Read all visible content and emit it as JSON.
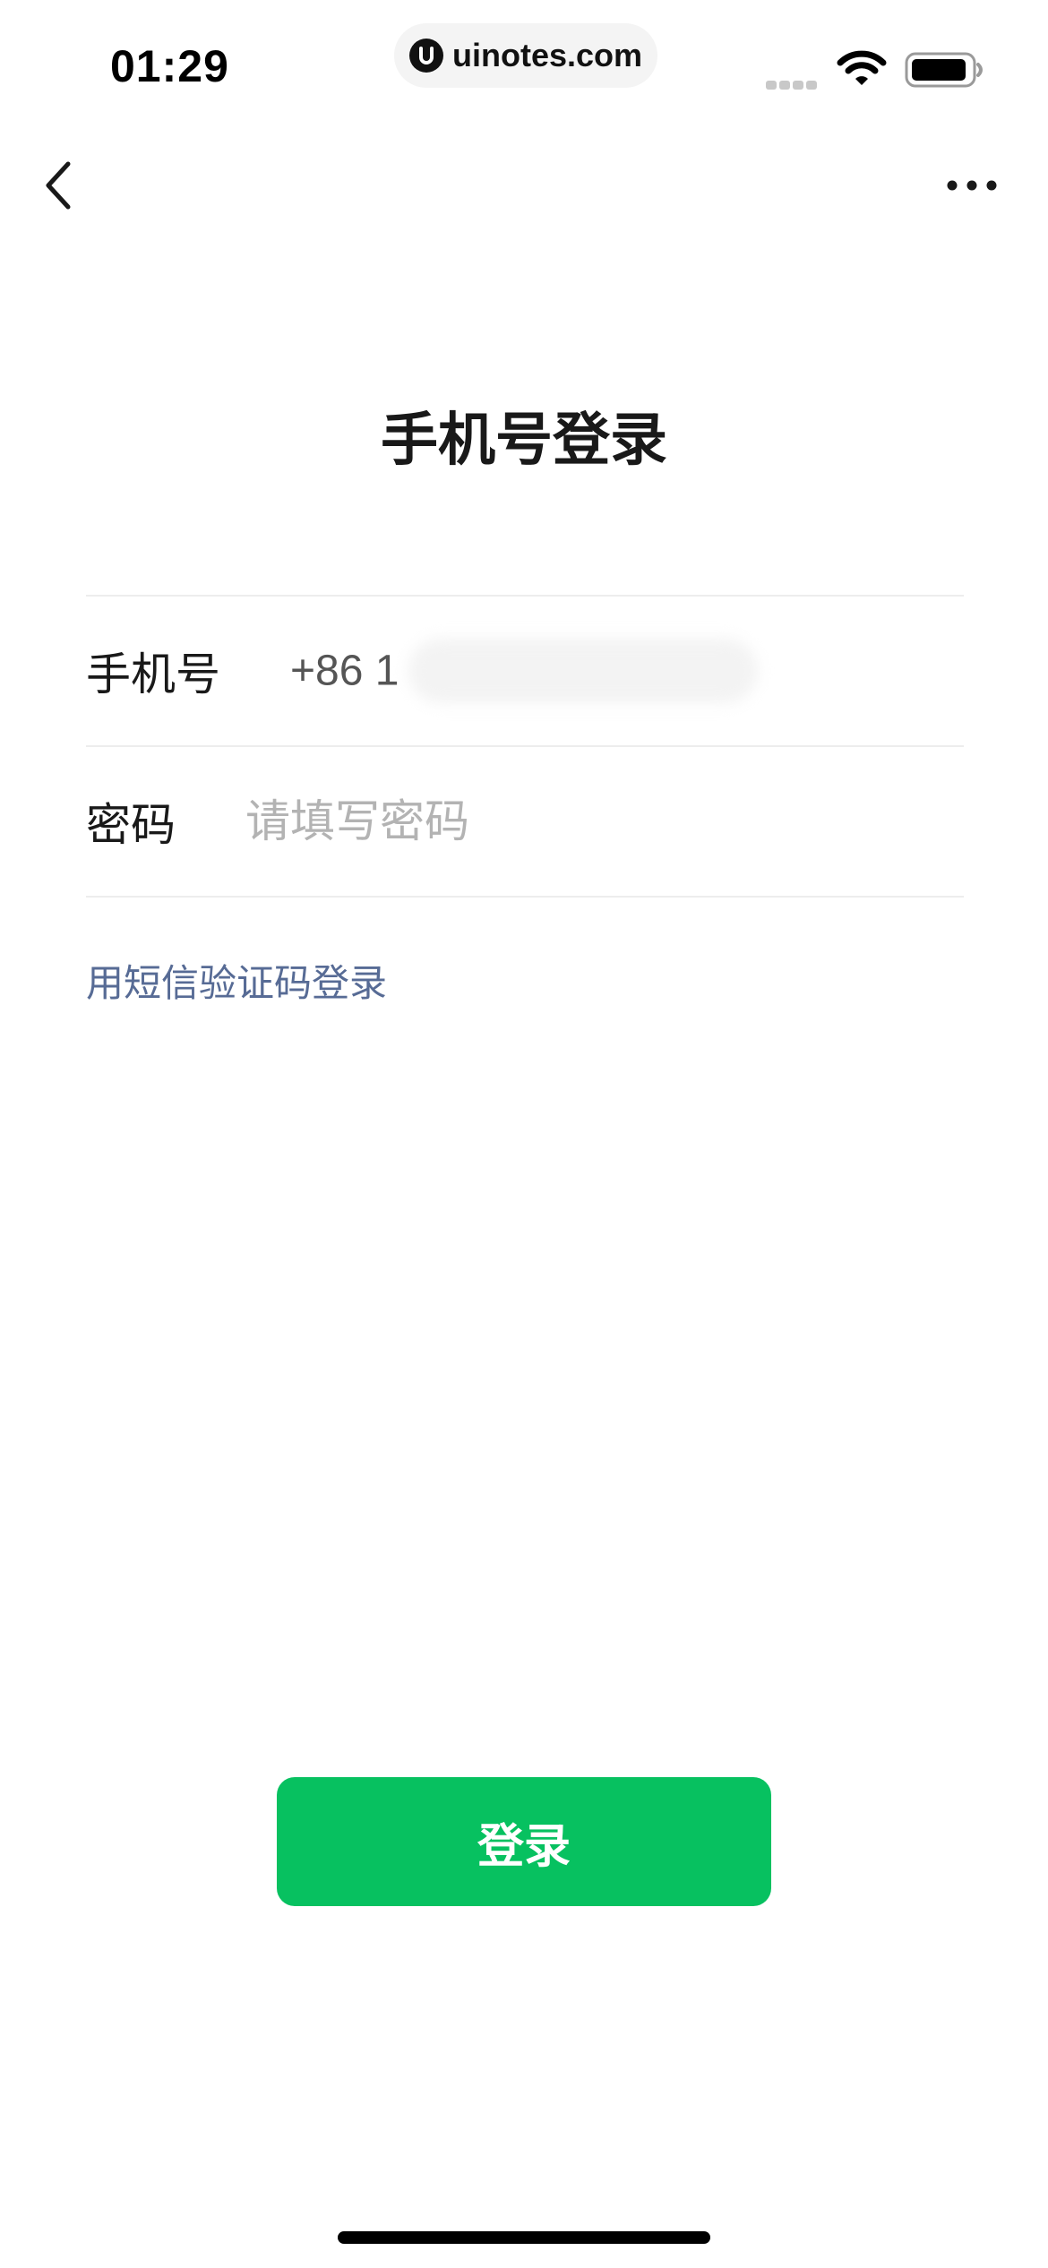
{
  "status_bar": {
    "time": "01:29",
    "url": "uinotes.com",
    "icons": [
      "cellular-signal-icon",
      "wifi-icon",
      "battery-icon"
    ]
  },
  "nav": {
    "back_icon": "chevron-left-icon",
    "more_icon": "more-dots-icon"
  },
  "page": {
    "title": "手机号登录"
  },
  "form": {
    "phone_label": "手机号",
    "phone_value": "+86 1",
    "password_label": "密码",
    "password_placeholder": "请填写密码"
  },
  "links": {
    "sms_login": "用短信验证码登录"
  },
  "actions": {
    "login_label": "登录"
  },
  "colors": {
    "primary_green": "#07c160",
    "link_blue": "#576b95",
    "placeholder_gray": "#b3b3b3",
    "divider": "#ededed"
  }
}
